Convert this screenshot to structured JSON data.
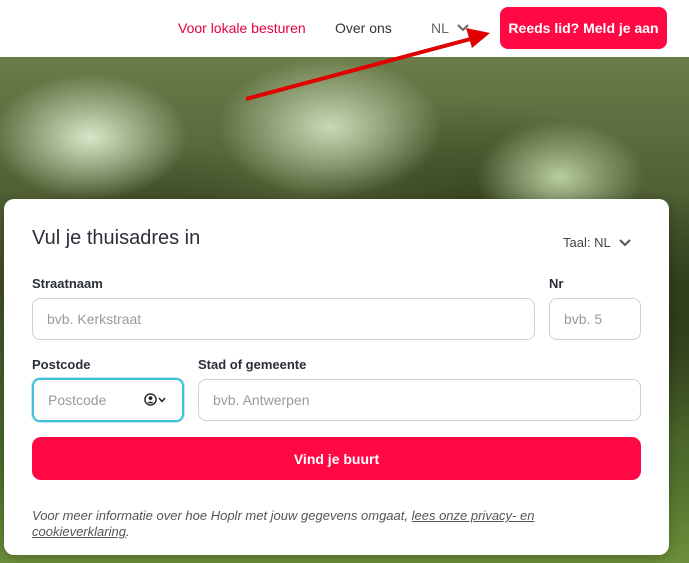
{
  "header": {
    "local_gov_link": "Voor lokale besturen",
    "about_link": "Over ons",
    "language": "NL",
    "login_button": "Reeds lid? Meld je aan"
  },
  "colors": {
    "brand": "#ff0844",
    "annotation": "#e00000",
    "focus": "#41c1d9"
  },
  "form": {
    "title": "Vul je thuisadres in",
    "language_label": "Taal: NL",
    "street": {
      "label": "Straatnaam",
      "placeholder": "bvb. Kerkstraat",
      "value": ""
    },
    "number": {
      "label": "Nr",
      "placeholder": "bvb. 5",
      "value": ""
    },
    "postcode": {
      "label": "Postcode",
      "placeholder": "Postcode",
      "value": "",
      "autofill_icon": "autofill-contact-icon"
    },
    "city": {
      "label": "Stad of gemeente",
      "placeholder": "bvb. Antwerpen",
      "value": ""
    },
    "submit_button": "Vind je buurt",
    "privacy_text": "Voor meer informatie over hoe Hoplr met jouw gegevens omgaat, ",
    "privacy_link": "lees onze privacy- en cookieverklaring",
    "privacy_end": "."
  }
}
